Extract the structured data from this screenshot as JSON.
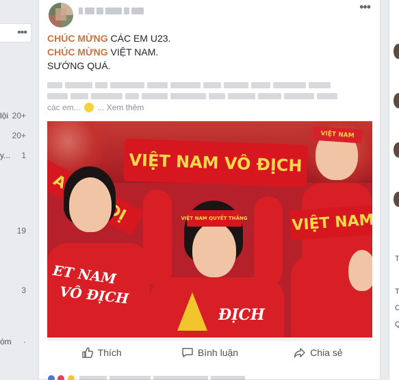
{
  "post": {
    "line1_highlight": "CHÚC MỪNG",
    "line1_rest": " CÁC EM U23.",
    "line2_highlight": "CHÚC MỪNG",
    "line2_rest": " VIỆT NAM.",
    "line3": "SƯỚNG QUÁ.",
    "see_more_prefix": "các em...",
    "see_more_tail": "...",
    "see_more_label": "Xem thêm",
    "photo_banner_text": "VIỆT NAM VÔ ĐỊCH",
    "photo_headband_text": "VIỆT NAM QUYẾT THẮNG",
    "photo_headband_man": "VIỆT NAM",
    "photo_banner_left": "AM VÔ ĐỊ",
    "photo_banner_right": "VIỆT NAM",
    "photo_shirt_left_1": "ET NAM",
    "photo_shirt_left_2": "VÔ ĐỊCH",
    "photo_shirt_center": "ĐỊCH"
  },
  "actions": {
    "like_label": "Thích",
    "comment_label": "Bình luận",
    "share_label": "Chia sẻ"
  },
  "left_sidebar": {
    "items": [
      {
        "label": "lội",
        "count": "20+"
      },
      {
        "label": "",
        "count": "20+"
      },
      {
        "label": "y...",
        "count": "1"
      },
      {
        "label": "",
        "count": "19"
      },
      {
        "label": "",
        "count": "3"
      },
      {
        "label": "óm",
        "count": "·"
      }
    ]
  },
  "right_sidebar": {
    "text1": "T",
    "text2": "Ti",
    "text3": "C",
    "text4": "Q"
  },
  "menu": {
    "dots": "•••"
  },
  "colors": {
    "highlight": "#c87343",
    "banner_red": "#d6171f",
    "banner_yellow": "#f6d64a"
  }
}
